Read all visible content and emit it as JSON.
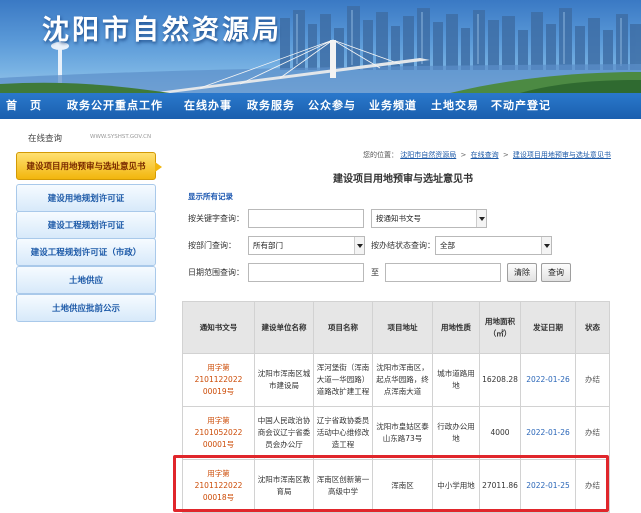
{
  "site_title": "沈阳市自然资源局",
  "nav": [
    "首　页",
    "政务公开重点工作",
    "在线办事",
    "政务服务",
    "公众参与",
    "业务频道",
    "土地交易",
    "不动产登记"
  ],
  "sidebar": {
    "header": "在线查询",
    "url_text": "WWW.SYSHST.GOV.CN",
    "items": [
      {
        "label": "建设项目用地预审与选址意见书",
        "active": true
      },
      {
        "label": "建设用地规划许可证",
        "active": false
      },
      {
        "label": "建设工程规划许可证",
        "active": false
      },
      {
        "label": "建设工程规划许可证（市政）",
        "active": false
      },
      {
        "label": "土地供应",
        "active": false
      },
      {
        "label": "土地供应批前公示",
        "active": false
      }
    ]
  },
  "breadcrumb": {
    "prefix": "您的位置：",
    "items": [
      "沈阳市自然资源局",
      "在线查询",
      "建设项目用地预审与选址意见书"
    ],
    "separator": ">"
  },
  "panel_title": "建设项目用地预审与选址意见书",
  "show_all": "显示所有记录",
  "search": {
    "keyword_label": "按关键字查询：",
    "keyword_value": "",
    "keyword_type": "按通知书文号",
    "dept_label": "按部门查询：",
    "dept_value": "所有部门",
    "status_label": "按办结状态查询：",
    "status_value": "全部",
    "date_label": "日期范围查询：",
    "date_to": "至",
    "clear_btn": "清除",
    "query_btn": "查询"
  },
  "table": {
    "headers": [
      "通知书文号",
      "建设单位名称",
      "项目名称",
      "项目地址",
      "用地性质",
      "用地面积\n（㎡）",
      "发证日期",
      "状态"
    ],
    "rows": [
      [
        "用字第2101122022\n00019号",
        "沈阳市浑南区城\n市建设局",
        "浑河堡街（浑南\n大道—华园路）\n道路改扩建工程",
        "沈阳市浑南区，\n起点华园路，终\n点浑南大道",
        "城市道路用地",
        "16208.28",
        "2022-01-26",
        "办结"
      ],
      [
        "用字第2101052022\n00001号",
        "中国人民政治协\n商会议辽宁省委\n员会办公厅",
        "辽宁省政协委员\n活动中心维修改\n造工程",
        "沈阳市皇姑区泰\n山东路73号",
        "行政办公用地",
        "4000",
        "2022-01-26",
        "办结"
      ],
      [
        "用字第2101122022\n00018号",
        "沈阳市浑南区教\n育局",
        "浑南区创新第一\n高级中学",
        "浑南区",
        "中小学用地",
        "27011.86",
        "2022-01-25",
        "办结"
      ]
    ]
  },
  "colors": {
    "nav_blue": "#1a5fae",
    "link_blue": "#1d5aa8",
    "code_orange": "#cc4b06",
    "highlight_red": "#e0262b",
    "active_gold": "#f2b60d"
  }
}
